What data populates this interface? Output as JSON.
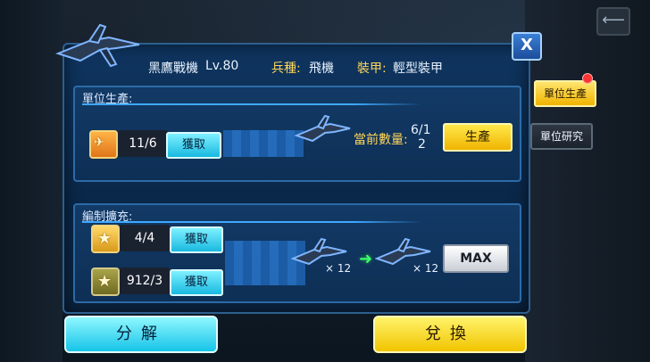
{
  "header": {
    "unit_name": "黑鷹戰機",
    "level": "Lv.80",
    "type_label": "兵種:",
    "type_value": "飛機",
    "armor_label": "裝甲:",
    "armor_value": "輕型裝甲"
  },
  "close_label": "X",
  "production": {
    "title": "單位生產:",
    "resource_count": "11/6",
    "get_label": "獲取",
    "current_qty_label": "當前數量:",
    "current_qty_value_top": "6/1",
    "current_qty_value_bottom": "2",
    "produce_label": "生產"
  },
  "expansion": {
    "title": "編制擴充:",
    "rows": [
      {
        "count": "4/4",
        "get_label": "獲取"
      },
      {
        "count": "912/3",
        "get_label": "獲取"
      }
    ],
    "from_multiplier": "× 12",
    "to_multiplier": "× 12",
    "max_label": "MAX"
  },
  "side_tabs": [
    {
      "label": "單位生產",
      "active": true
    },
    {
      "label": "單位研究",
      "active": false
    }
  ],
  "bottom": {
    "disassemble": "分解",
    "exchange": "兌換"
  }
}
